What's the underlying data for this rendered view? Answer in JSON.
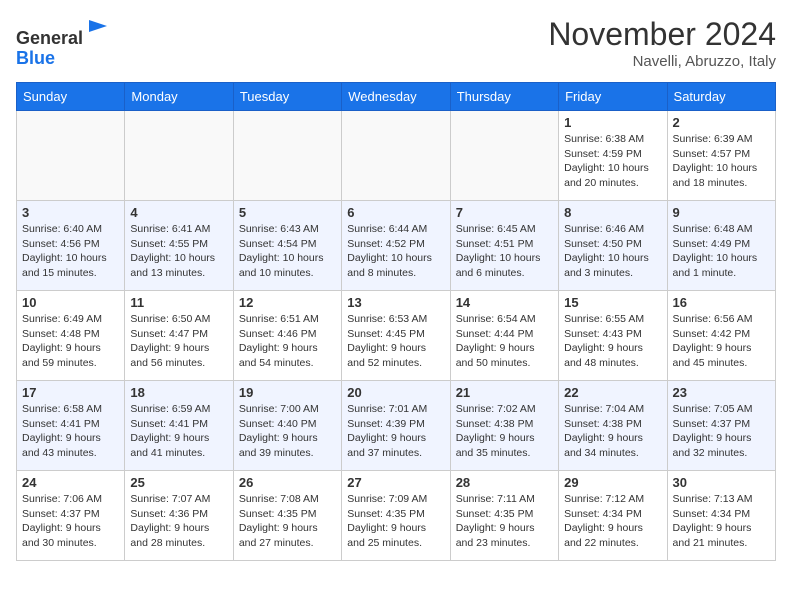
{
  "header": {
    "logo_line1": "General",
    "logo_line2": "Blue",
    "month": "November 2024",
    "location": "Navelli, Abruzzo, Italy"
  },
  "weekdays": [
    "Sunday",
    "Monday",
    "Tuesday",
    "Wednesday",
    "Thursday",
    "Friday",
    "Saturday"
  ],
  "weeks": [
    [
      {
        "day": "",
        "info": ""
      },
      {
        "day": "",
        "info": ""
      },
      {
        "day": "",
        "info": ""
      },
      {
        "day": "",
        "info": ""
      },
      {
        "day": "",
        "info": ""
      },
      {
        "day": "1",
        "info": "Sunrise: 6:38 AM\nSunset: 4:59 PM\nDaylight: 10 hours and 20 minutes."
      },
      {
        "day": "2",
        "info": "Sunrise: 6:39 AM\nSunset: 4:57 PM\nDaylight: 10 hours and 18 minutes."
      }
    ],
    [
      {
        "day": "3",
        "info": "Sunrise: 6:40 AM\nSunset: 4:56 PM\nDaylight: 10 hours and 15 minutes."
      },
      {
        "day": "4",
        "info": "Sunrise: 6:41 AM\nSunset: 4:55 PM\nDaylight: 10 hours and 13 minutes."
      },
      {
        "day": "5",
        "info": "Sunrise: 6:43 AM\nSunset: 4:54 PM\nDaylight: 10 hours and 10 minutes."
      },
      {
        "day": "6",
        "info": "Sunrise: 6:44 AM\nSunset: 4:52 PM\nDaylight: 10 hours and 8 minutes."
      },
      {
        "day": "7",
        "info": "Sunrise: 6:45 AM\nSunset: 4:51 PM\nDaylight: 10 hours and 6 minutes."
      },
      {
        "day": "8",
        "info": "Sunrise: 6:46 AM\nSunset: 4:50 PM\nDaylight: 10 hours and 3 minutes."
      },
      {
        "day": "9",
        "info": "Sunrise: 6:48 AM\nSunset: 4:49 PM\nDaylight: 10 hours and 1 minute."
      }
    ],
    [
      {
        "day": "10",
        "info": "Sunrise: 6:49 AM\nSunset: 4:48 PM\nDaylight: 9 hours and 59 minutes."
      },
      {
        "day": "11",
        "info": "Sunrise: 6:50 AM\nSunset: 4:47 PM\nDaylight: 9 hours and 56 minutes."
      },
      {
        "day": "12",
        "info": "Sunrise: 6:51 AM\nSunset: 4:46 PM\nDaylight: 9 hours and 54 minutes."
      },
      {
        "day": "13",
        "info": "Sunrise: 6:53 AM\nSunset: 4:45 PM\nDaylight: 9 hours and 52 minutes."
      },
      {
        "day": "14",
        "info": "Sunrise: 6:54 AM\nSunset: 4:44 PM\nDaylight: 9 hours and 50 minutes."
      },
      {
        "day": "15",
        "info": "Sunrise: 6:55 AM\nSunset: 4:43 PM\nDaylight: 9 hours and 48 minutes."
      },
      {
        "day": "16",
        "info": "Sunrise: 6:56 AM\nSunset: 4:42 PM\nDaylight: 9 hours and 45 minutes."
      }
    ],
    [
      {
        "day": "17",
        "info": "Sunrise: 6:58 AM\nSunset: 4:41 PM\nDaylight: 9 hours and 43 minutes."
      },
      {
        "day": "18",
        "info": "Sunrise: 6:59 AM\nSunset: 4:41 PM\nDaylight: 9 hours and 41 minutes."
      },
      {
        "day": "19",
        "info": "Sunrise: 7:00 AM\nSunset: 4:40 PM\nDaylight: 9 hours and 39 minutes."
      },
      {
        "day": "20",
        "info": "Sunrise: 7:01 AM\nSunset: 4:39 PM\nDaylight: 9 hours and 37 minutes."
      },
      {
        "day": "21",
        "info": "Sunrise: 7:02 AM\nSunset: 4:38 PM\nDaylight: 9 hours and 35 minutes."
      },
      {
        "day": "22",
        "info": "Sunrise: 7:04 AM\nSunset: 4:38 PM\nDaylight: 9 hours and 34 minutes."
      },
      {
        "day": "23",
        "info": "Sunrise: 7:05 AM\nSunset: 4:37 PM\nDaylight: 9 hours and 32 minutes."
      }
    ],
    [
      {
        "day": "24",
        "info": "Sunrise: 7:06 AM\nSunset: 4:37 PM\nDaylight: 9 hours and 30 minutes."
      },
      {
        "day": "25",
        "info": "Sunrise: 7:07 AM\nSunset: 4:36 PM\nDaylight: 9 hours and 28 minutes."
      },
      {
        "day": "26",
        "info": "Sunrise: 7:08 AM\nSunset: 4:35 PM\nDaylight: 9 hours and 27 minutes."
      },
      {
        "day": "27",
        "info": "Sunrise: 7:09 AM\nSunset: 4:35 PM\nDaylight: 9 hours and 25 minutes."
      },
      {
        "day": "28",
        "info": "Sunrise: 7:11 AM\nSunset: 4:35 PM\nDaylight: 9 hours and 23 minutes."
      },
      {
        "day": "29",
        "info": "Sunrise: 7:12 AM\nSunset: 4:34 PM\nDaylight: 9 hours and 22 minutes."
      },
      {
        "day": "30",
        "info": "Sunrise: 7:13 AM\nSunset: 4:34 PM\nDaylight: 9 hours and 21 minutes."
      }
    ]
  ]
}
